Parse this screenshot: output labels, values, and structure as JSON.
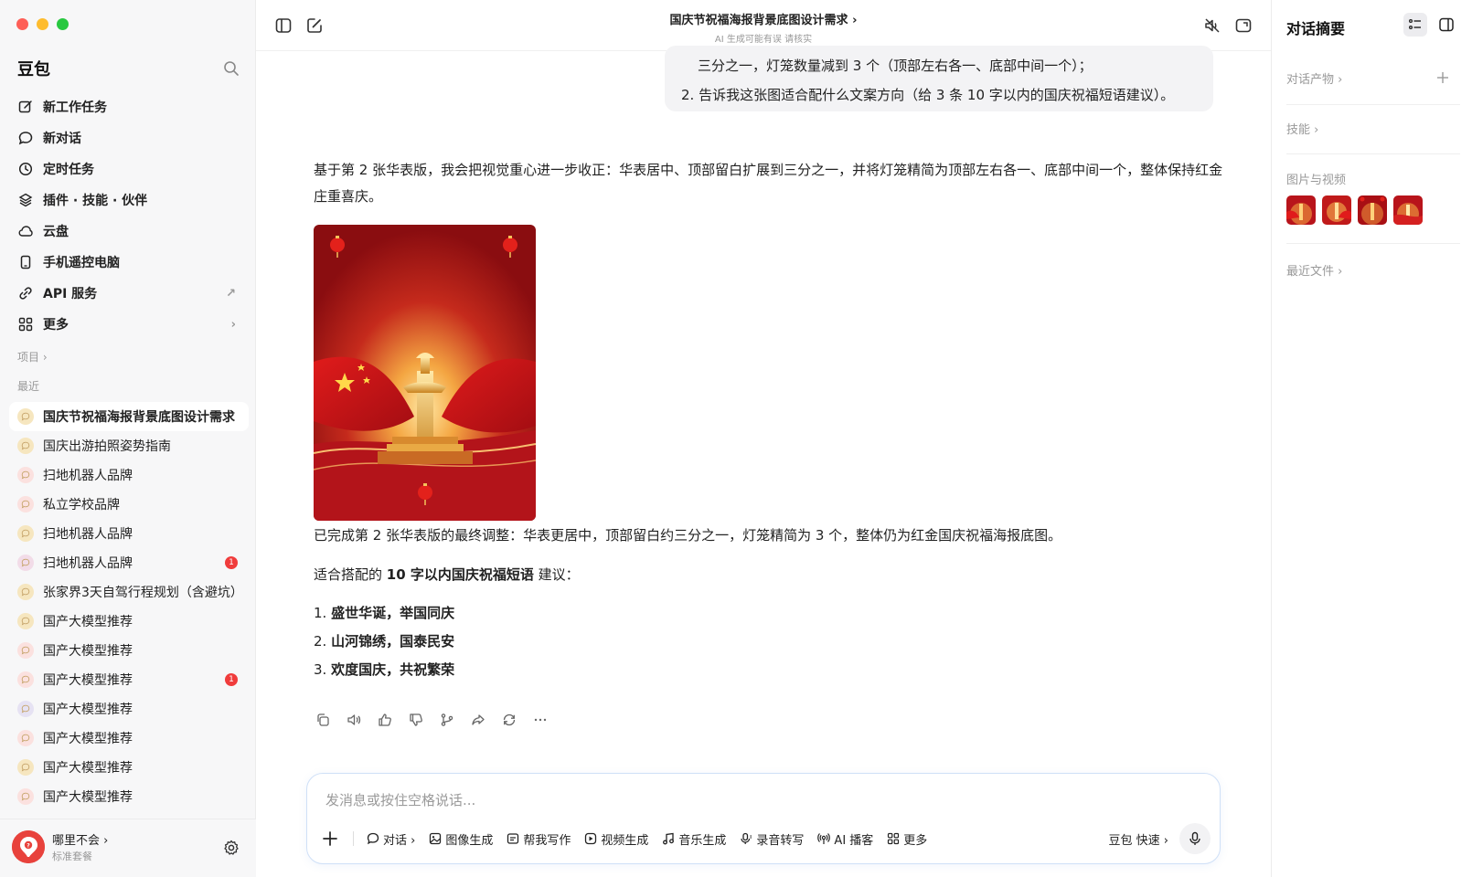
{
  "sidebar": {
    "brand": "豆包",
    "nav": [
      {
        "label": "新工作任务",
        "icon": "edit-icon"
      },
      {
        "label": "新对话",
        "icon": "chat-bubble-icon"
      },
      {
        "label": "定时任务",
        "icon": "clock-icon"
      },
      {
        "label": "插件 · 技能 · 伙伴",
        "icon": "layers-icon"
      },
      {
        "label": "云盘",
        "icon": "cloud-icon"
      },
      {
        "label": "手机遥控电脑",
        "icon": "phone-icon"
      },
      {
        "label": "API 服务",
        "icon": "api-icon",
        "tail": "↗"
      },
      {
        "label": "更多",
        "icon": "grid-icon",
        "tail": "›"
      }
    ],
    "projects_label": "项目 ›",
    "recent_label": "最近",
    "recent": [
      {
        "label": "国庆节祝福海报背景底图设计需求",
        "active": true,
        "badge": ""
      },
      {
        "label": "国庆出游拍照姿势指南",
        "active": false,
        "badge": ""
      },
      {
        "label": "扫地机器人品牌",
        "active": false,
        "badge": ""
      },
      {
        "label": "私立学校品牌",
        "active": false,
        "badge": ""
      },
      {
        "label": "扫地机器人品牌",
        "active": false,
        "badge": ""
      },
      {
        "label": "扫地机器人品牌",
        "active": false,
        "badge": "1"
      },
      {
        "label": "张家界3天自驾行程规划（含避坑）",
        "active": false,
        "badge": ""
      },
      {
        "label": "国产大模型推荐",
        "active": false,
        "badge": ""
      },
      {
        "label": "国产大模型推荐",
        "active": false,
        "badge": ""
      },
      {
        "label": "国产大模型推荐",
        "active": false,
        "badge": "1"
      },
      {
        "label": "国产大模型推荐",
        "active": false,
        "badge": ""
      },
      {
        "label": "国产大模型推荐",
        "active": false,
        "badge": ""
      },
      {
        "label": "国产大模型推荐",
        "active": false,
        "badge": ""
      },
      {
        "label": "国产大模型推荐",
        "active": false,
        "badge": ""
      }
    ],
    "user": {
      "name": "哪里不会 ›",
      "plan": "标准套餐"
    }
  },
  "topbar": {
    "title": "国庆节祝福海报背景底图设计需求 ›",
    "subtitle": "AI 生成可能有误 请核实"
  },
  "chat": {
    "user_message": {
      "line1": "三分之一，灯笼数量减到 3 个（顶部左右各一、底部中间一个）；",
      "line2": "2. 告诉我这张图适合配什么文案方向（给 3 条 10 字以内的国庆祝福短语建议）。"
    },
    "reply_intro": "基于第 2 张华表版，我会把视觉重心进一步收正：华表居中、顶部留白扩展到三分之一，并将灯笼精简为顶部左右各一、底部中间一个，整体保持红金庄重喜庆。",
    "reply_done": "已完成第 2 张华表版的最终调整：华表更居中，顶部留白约三分之一，灯笼精简为 3 个，整体仍为红金国庆祝福海报底图。",
    "suggest_prefix": "适合搭配的 ",
    "suggest_bold": "10 字以内国庆祝福短语",
    "suggest_suffix": " 建议：",
    "phrases": [
      {
        "num": "1. ",
        "text": "盛世华诞，举国同庆"
      },
      {
        "num": "2. ",
        "text": "山河锦绣，国泰民安"
      },
      {
        "num": "3. ",
        "text": "欢度国庆，共祝繁荣"
      }
    ]
  },
  "input": {
    "placeholder": "发消息或按住空格说话...",
    "tools": [
      {
        "label": "对话 ›",
        "icon": "chat-bubble-icon"
      },
      {
        "label": "图像生成",
        "icon": "image-icon"
      },
      {
        "label": "帮我写作",
        "icon": "write-icon"
      },
      {
        "label": "视频生成",
        "icon": "video-icon"
      },
      {
        "label": "音乐生成",
        "icon": "music-icon"
      },
      {
        "label": "录音转写",
        "icon": "record-icon"
      },
      {
        "label": "AI 播客",
        "icon": "podcast-icon"
      },
      {
        "label": "更多",
        "icon": "grid-icon"
      }
    ],
    "model": "豆包 快速 ›"
  },
  "right_panel": {
    "title": "对话摘要",
    "sections": {
      "artifacts": "对话产物 ›",
      "skills": "技能 ›",
      "media": "图片与视频",
      "files": "最近文件 ›"
    }
  },
  "colors": {
    "accent_red": "#e8423c",
    "poster_red": "#b8141b",
    "gold": "#f5c35a",
    "input_border": "#cfe0f7"
  }
}
